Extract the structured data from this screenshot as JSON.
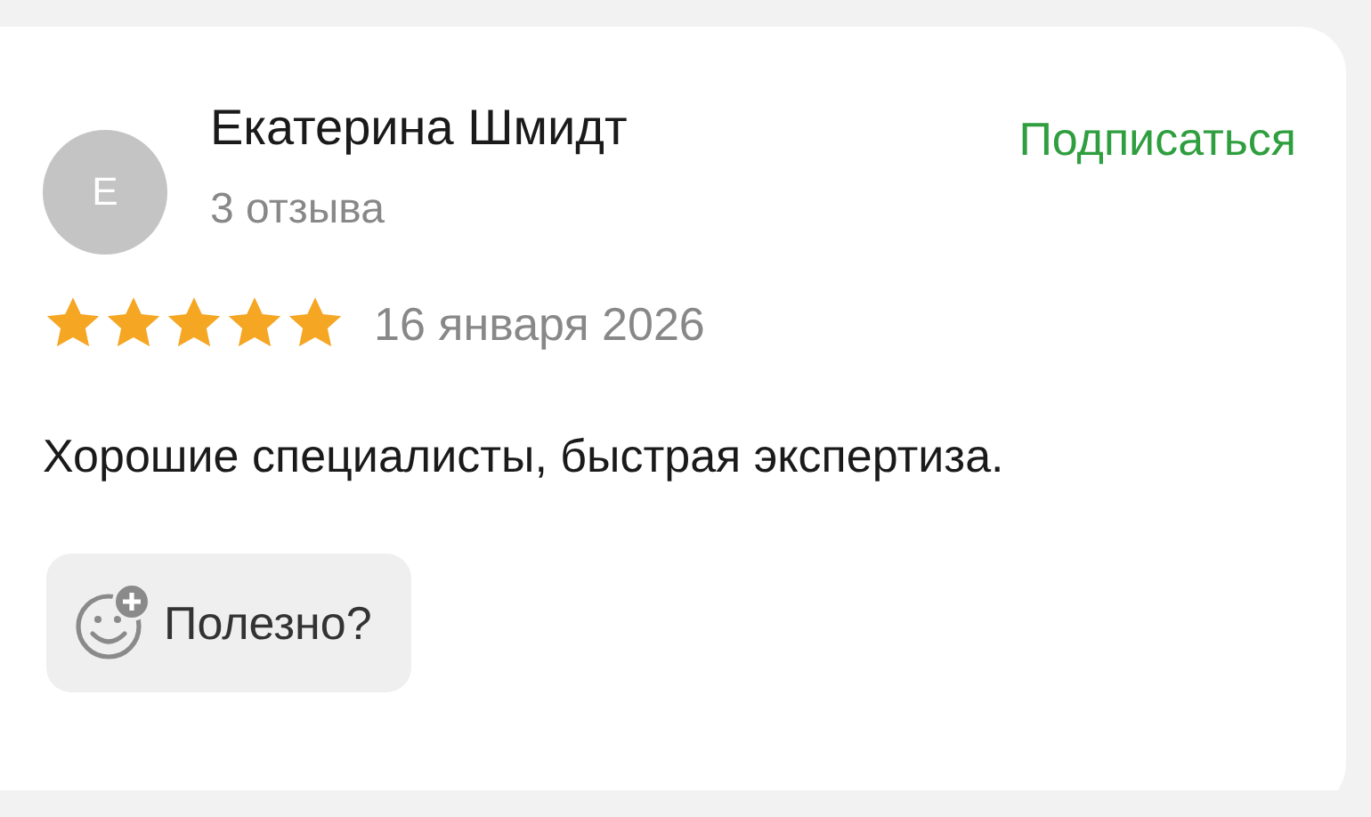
{
  "author": {
    "initial": "Е",
    "name": "Екатерина Шмидт",
    "reviews": "3 отзыва"
  },
  "subscribe": "Подписаться",
  "rating": {
    "stars": 5
  },
  "date": "16 января 2026",
  "text": "Хорошие специалисты, быстрая экспертиза.",
  "helpful": "Полезно?"
}
